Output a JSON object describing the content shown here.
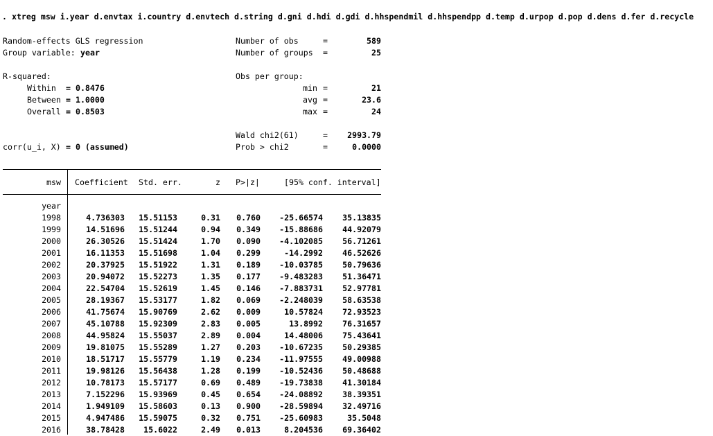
{
  "command": ". xtreg msw i.year d.envtax i.country d.envtech d.string d.gni d.hdi d.gdi d.hhspendmil d.hhspendpp d.temp d.urpop d.pop d.dens d.fer d.recycle",
  "header": {
    "model_title": "Random-effects GLS regression",
    "group_var_label": "Group variable:",
    "group_var": "year",
    "r2_label": "R-squared:",
    "within_label": "Within",
    "within": "= 0.8476",
    "between_label": "Between",
    "between": "= 1.0000",
    "overall_label": "Overall",
    "overall": "= 0.8503",
    "corr_label": "corr(u_i, X)",
    "corr_value": "= 0 (assumed)",
    "nobs_label": "Number of obs",
    "nobs": "589",
    "ngroups_label": "Number of groups",
    "ngroups": "25",
    "obs_per_group_label": "Obs per group:",
    "min_label": "min",
    "min": "21",
    "avg_label": "avg",
    "avg": "23.6",
    "max_label": "max",
    "max": "24",
    "wald_label": "Wald chi2(61)",
    "wald": "2993.79",
    "prob_label": "Prob > chi2",
    "prob": "0.0000",
    "eq": "="
  },
  "table": {
    "depvar": "msw",
    "columns": [
      "Coefficient",
      "Std. err.",
      "z",
      "P>|z|",
      "[95% conf. interval]"
    ],
    "group_label": "year",
    "rows": [
      {
        "label": "1998",
        "coef": "4.736303",
        "se": "15.51153",
        "z": "0.31",
        "p": "0.760",
        "lo": "-25.66574",
        "hi": "35.13835"
      },
      {
        "label": "1999",
        "coef": "14.51696",
        "se": "15.51244",
        "z": "0.94",
        "p": "0.349",
        "lo": "-15.88686",
        "hi": "44.92079"
      },
      {
        "label": "2000",
        "coef": "26.30526",
        "se": "15.51424",
        "z": "1.70",
        "p": "0.090",
        "lo": "-4.102085",
        "hi": "56.71261"
      },
      {
        "label": "2001",
        "coef": "16.11353",
        "se": "15.51698",
        "z": "1.04",
        "p": "0.299",
        "lo": "-14.2992",
        "hi": "46.52626"
      },
      {
        "label": "2002",
        "coef": "20.37925",
        "se": "15.51922",
        "z": "1.31",
        "p": "0.189",
        "lo": "-10.03785",
        "hi": "50.79636"
      },
      {
        "label": "2003",
        "coef": "20.94072",
        "se": "15.52273",
        "z": "1.35",
        "p": "0.177",
        "lo": "-9.483283",
        "hi": "51.36471"
      },
      {
        "label": "2004",
        "coef": "22.54704",
        "se": "15.52619",
        "z": "1.45",
        "p": "0.146",
        "lo": "-7.883731",
        "hi": "52.97781"
      },
      {
        "label": "2005",
        "coef": "28.19367",
        "se": "15.53177",
        "z": "1.82",
        "p": "0.069",
        "lo": "-2.248039",
        "hi": "58.63538"
      },
      {
        "label": "2006",
        "coef": "41.75674",
        "se": "15.90769",
        "z": "2.62",
        "p": "0.009",
        "lo": "10.57824",
        "hi": "72.93523"
      },
      {
        "label": "2007",
        "coef": "45.10788",
        "se": "15.92309",
        "z": "2.83",
        "p": "0.005",
        "lo": "13.8992",
        "hi": "76.31657"
      },
      {
        "label": "2008",
        "coef": "44.95824",
        "se": "15.55037",
        "z": "2.89",
        "p": "0.004",
        "lo": "14.48006",
        "hi": "75.43641"
      },
      {
        "label": "2009",
        "coef": "19.81075",
        "se": "15.55289",
        "z": "1.27",
        "p": "0.203",
        "lo": "-10.67235",
        "hi": "50.29385"
      },
      {
        "label": "2010",
        "coef": "18.51717",
        "se": "15.55779",
        "z": "1.19",
        "p": "0.234",
        "lo": "-11.97555",
        "hi": "49.00988"
      },
      {
        "label": "2011",
        "coef": "19.98126",
        "se": "15.56438",
        "z": "1.28",
        "p": "0.199",
        "lo": "-10.52436",
        "hi": "50.48688"
      },
      {
        "label": "2012",
        "coef": "10.78173",
        "se": "15.57177",
        "z": "0.69",
        "p": "0.489",
        "lo": "-19.73838",
        "hi": "41.30184"
      },
      {
        "label": "2013",
        "coef": "7.152296",
        "se": "15.93969",
        "z": "0.45",
        "p": "0.654",
        "lo": "-24.08892",
        "hi": "38.39351"
      },
      {
        "label": "2014",
        "coef": "1.949109",
        "se": "15.58603",
        "z": "0.13",
        "p": "0.900",
        "lo": "-28.59894",
        "hi": "32.49716"
      },
      {
        "label": "2015",
        "coef": "4.947486",
        "se": "15.59075",
        "z": "0.32",
        "p": "0.751",
        "lo": "-25.60983",
        "hi": "35.5048"
      },
      {
        "label": "2016",
        "coef": "38.78428",
        "se": "15.6022",
        "z": "2.49",
        "p": "0.013",
        "lo": "8.204536",
        "hi": "69.36402"
      }
    ]
  }
}
